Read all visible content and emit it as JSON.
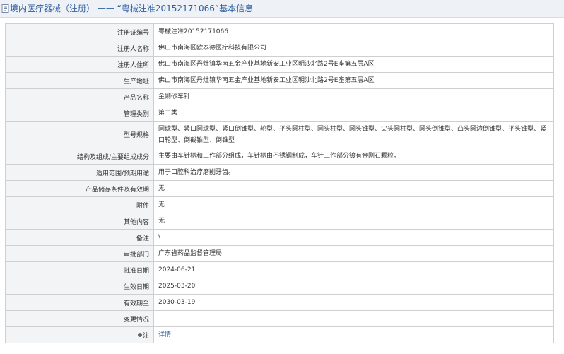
{
  "header": {
    "breadcrumb": "境内医疗器械（注册）",
    "separator": "——",
    "title": "“粤械注准20152171066”基本信息"
  },
  "rows": [
    {
      "label": "注册证编号",
      "value": "粤械注准20152171066"
    },
    {
      "label": "注册人名称",
      "value": "佛山市南海区欧泰德医疗科技有限公司"
    },
    {
      "label": "注册人住所",
      "value": "佛山市南海区丹灶镇华南五金产业基地新安工业区明沙北路2号E座第五层A区"
    },
    {
      "label": "生产地址",
      "value": "佛山市南海区丹灶镇华南五金产业基地新安工业区明沙北路2号E座第五层A区"
    },
    {
      "label": "产品名称",
      "value": "金刚砂车针"
    },
    {
      "label": "管理类别",
      "value": "第二类"
    },
    {
      "label": "型号规格",
      "value": "圆球型、紧口圆球型、紧口倒锥型、轮型、平头圆柱型、圆头柱型、圆头锥型、尖头圆柱型、圆头倒锥型、凸头圆边倒锥型、平头锥型、紧口轮型、倒截锥型、倒锥型"
    },
    {
      "label": "结构及组成/主要组成成分",
      "value": "主要由车针柄和工作部分组成，车针柄由不锈钢制成，车针工作部分镀有金刚石颗粒。"
    },
    {
      "label": "适用范围/预期用途",
      "value": "用于口腔科治疗磨削牙齿。"
    },
    {
      "label": "产品储存条件及有效期",
      "value": "无"
    },
    {
      "label": "附件",
      "value": "无"
    },
    {
      "label": "其他内容",
      "value": "无"
    },
    {
      "label": "备注",
      "value": "\\"
    },
    {
      "label": "审批部门",
      "value": "广东省药品监督管理局"
    },
    {
      "label": "批准日期",
      "value": "2024-06-21"
    },
    {
      "label": "生效日期",
      "value": "2025-03-20"
    },
    {
      "label": "有效期至",
      "value": "2030-03-19"
    },
    {
      "label": "变更情况",
      "value": ""
    }
  ],
  "note": {
    "label": "注",
    "value": "详情"
  },
  "icons": {
    "header": "document-icon",
    "note": "pin-icon"
  },
  "colors": {
    "link": "#2f5f9e",
    "label_bg": "#f3f4f6",
    "header_bg": "#eef1f6"
  }
}
